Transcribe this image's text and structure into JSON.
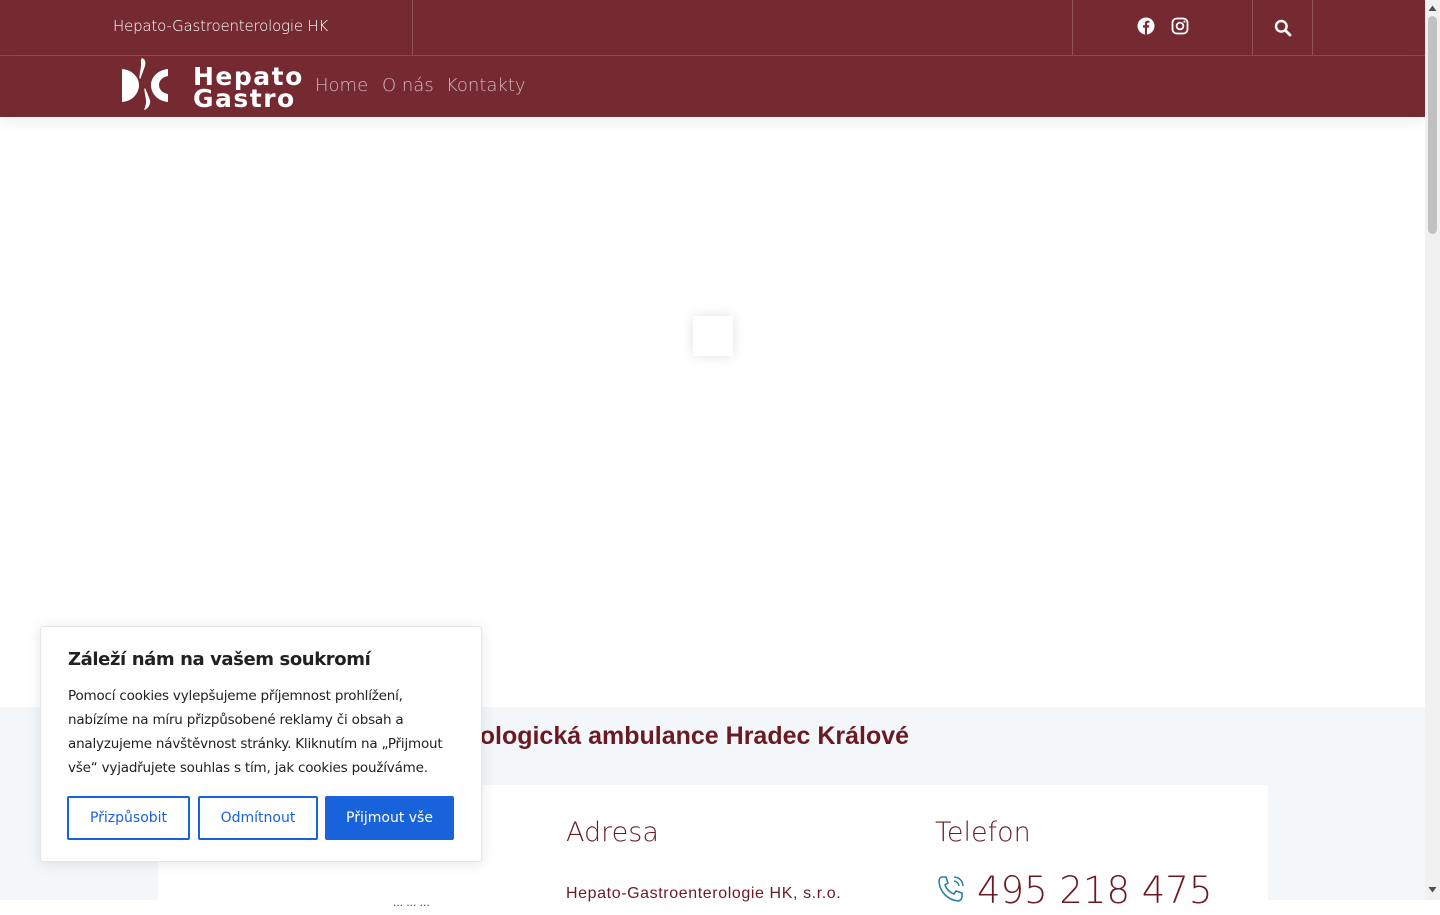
{
  "topbar": {
    "site_name": "Hepato-Gastroenterologie HK",
    "icons": [
      "facebook-icon",
      "instagram-icon",
      "search-icon"
    ]
  },
  "nav": {
    "logo_line1": "Hepato",
    "logo_line2": "Gastro",
    "items": [
      {
        "label": "Home"
      },
      {
        "label": "O nás"
      },
      {
        "label": "Kontakty"
      }
    ]
  },
  "info": {
    "section_title": "rologická ambulance Hradec Králové",
    "address_heading": "Adresa",
    "address_line1": "Hepato-Gastroenterologie HK, s.r.o.",
    "phone_heading": "Telefon",
    "phone_number": "495 218 475",
    "left_fragment": "... ...  ..."
  },
  "cookie": {
    "title": "Záleží nám na vašem soukromí",
    "text": "Pomocí cookies vylepšujeme příjemnost prohlížení, nabízíme na míru přizpůsobené reklamy či obsah a analyzujeme návštěvnost stránky. Kliknutím na „Přijmout vše“ vyjadřujete souhlas s tím, jak cookies používáme.",
    "customize_label": "Přizpůsobit",
    "reject_label": "Odmítnout",
    "accept_label": "Přijmout vše"
  },
  "colors": {
    "brand": "#752a32",
    "heading": "#6b1a24",
    "button_blue": "#1863dc",
    "section_bg": "#f4f7f9"
  }
}
